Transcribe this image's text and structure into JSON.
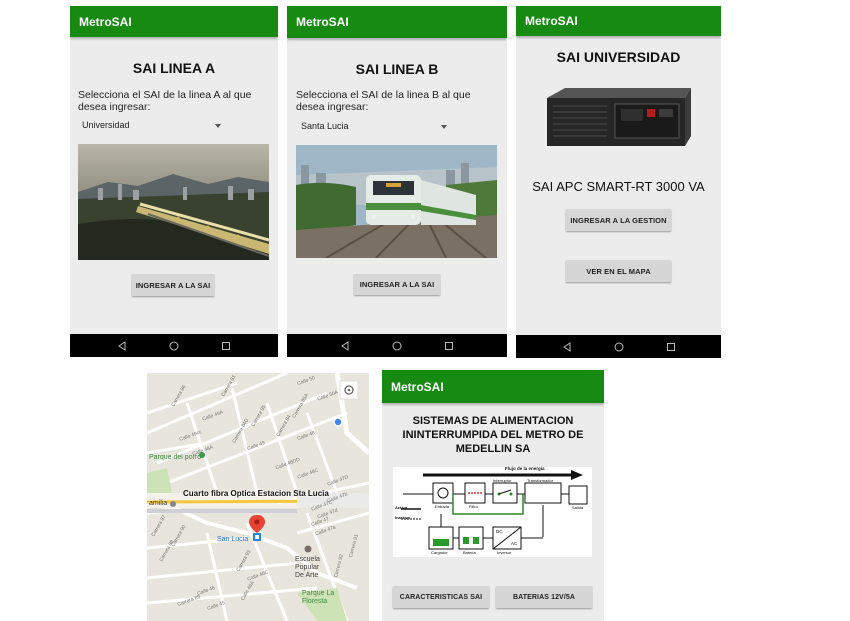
{
  "app_name": "MetroSAI",
  "screen_a": {
    "title": "SAI LINEA A",
    "prompt": "Selecciona el SAI de la linea A al que desea ingresar:",
    "selected": "Universidad",
    "button": "INGRESAR A LA SAI"
  },
  "screen_b": {
    "title": "SAI LINEA B",
    "prompt": "Selecciona el SAI de la linea B al que desea ingresar:",
    "selected": "Santa Lucia",
    "button": "INGRESAR A LA SAI"
  },
  "screen_c": {
    "title": "SAI UNIVERSIDAD",
    "device": "SAI APC SMART-RT 3000 VA",
    "button_manage": "INGRESAR A LA GESTION",
    "button_map": "VER EN EL MAPA"
  },
  "map": {
    "marker_label": "Cuarto fibra Optica Estacion Sta Lucia",
    "station": "San Lucia",
    "park": "Parque del porro",
    "school": "Escuela Popular de Arte",
    "school_l1": "Escuela",
    "school_l2": "Popular",
    "school_l3": "De Arte",
    "park2_l1": "Parque La",
    "park2_l2": "Floresta",
    "familia": "amilia",
    "streets": [
      "Calle 49cc",
      "Calle 49",
      "Calle 48DD",
      "Calle 48",
      "Calle 47",
      "Calle 47d",
      "Calle 47C",
      "Calle 47b",
      "Calle 47a",
      "Calle 46",
      "Calle 45",
      "Calle 50",
      "Calle 48C",
      "Calle 46A",
      "Carrera 84",
      "Carrera 85",
      "Carrera 84D",
      "Carrera 86",
      "Carrera 87",
      "Carrera 88",
      "Carrera 89",
      "Carrera 90",
      "Carrera 91",
      "Carrera 92",
      "Carrera 93",
      "Carrera 85A",
      "Calle 47D",
      "Calle 48A",
      "Calle 49A",
      "Calle 46C",
      "Calle 50A",
      "Carrera 81"
    ]
  },
  "screen_d": {
    "title": "SISTEMAS DE ALIMENTACION ININTERRUMPIDA DEL METRO DE MEDELLIN SA",
    "diagram": {
      "flow": "Flujo de la energía",
      "entrada": "Entrada",
      "filtro": "Filtro",
      "interruptor": "Interruptor",
      "transformador": "Transformador",
      "salida": "Salida",
      "activo": "Activo",
      "inactivo": "Inactivo",
      "cargador": "Cargador",
      "bateria": "Bateria",
      "inversor": "Inversor",
      "dc": "DC",
      "ac": "AC"
    },
    "button_left": "CARACTERISTICAS SAI",
    "button_right": "BATERIAS 12V/5A"
  }
}
